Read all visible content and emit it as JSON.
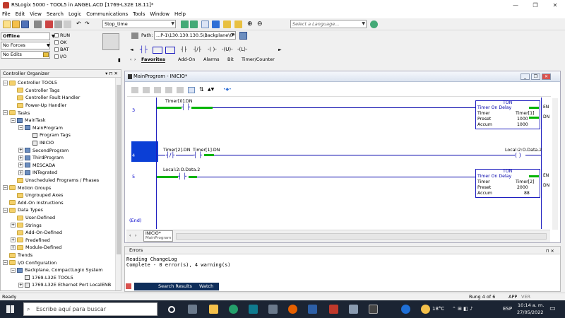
{
  "window": {
    "title": "RSLogix 5000 - TOOL5 in ANGEL.ACD [1769-L32E 18.11]*",
    "controls": [
      "—",
      "❐",
      "✕"
    ]
  },
  "menu": [
    "File",
    "Edit",
    "View",
    "Search",
    "Logic",
    "Communications",
    "Tools",
    "Window",
    "Help"
  ],
  "toolbar": {
    "search_combo": "Stop_time",
    "language_placeholder": "Select a Language...",
    "path_label": "Path:",
    "path_value": "...P-1\\130.130.130.5\\Backplane\\0*",
    "ladder_tabs": [
      "Favorites",
      "Add-On",
      "Alarms",
      "Bit",
      "Timer/Counter"
    ],
    "ladder_symbols": [
      "┤├",
      "┤/├",
      "-( )-",
      "-(U)-",
      "-(L)-"
    ]
  },
  "status": {
    "mode": "Offline",
    "forces": "No Forces",
    "edits": "No Edits",
    "checks": [
      "RUN",
      "OK",
      "BAT",
      "I/O"
    ]
  },
  "organizer": {
    "title": "Controller Organizer",
    "pin": "▾ ⊓ ✕",
    "items": [
      {
        "label": "Controller TOOL5",
        "indent": 0,
        "icon": "folder",
        "exp": "−"
      },
      {
        "label": "Controller Tags",
        "indent": 1,
        "icon": "folder",
        "exp": ""
      },
      {
        "label": "Controller Fault Handler",
        "indent": 1,
        "icon": "folder",
        "exp": ""
      },
      {
        "label": "Power-Up Handler",
        "indent": 1,
        "icon": "folder",
        "exp": ""
      },
      {
        "label": "Tasks",
        "indent": 0,
        "icon": "folder",
        "exp": "−"
      },
      {
        "label": "MainTask",
        "indent": 1,
        "icon": "pgm",
        "exp": "−"
      },
      {
        "label": "MainProgram",
        "indent": 2,
        "icon": "pgm",
        "exp": "−"
      },
      {
        "label": "Program Tags",
        "indent": 3,
        "icon": "rout",
        "exp": ""
      },
      {
        "label": "INICIO",
        "indent": 3,
        "icon": "rout",
        "exp": ""
      },
      {
        "label": "SecondProgram",
        "indent": 2,
        "icon": "pgm",
        "exp": "+"
      },
      {
        "label": "ThirdProgram",
        "indent": 2,
        "icon": "pgm",
        "exp": "+"
      },
      {
        "label": "MESCADA",
        "indent": 2,
        "icon": "pgm",
        "exp": "+"
      },
      {
        "label": "INTegrated",
        "indent": 2,
        "icon": "pgm",
        "exp": "+"
      },
      {
        "label": "Unscheduled Programs / Phases",
        "indent": 1,
        "icon": "folder",
        "exp": ""
      },
      {
        "label": "Motion Groups",
        "indent": 0,
        "icon": "folder",
        "exp": "−"
      },
      {
        "label": "Ungrouped Axes",
        "indent": 1,
        "icon": "folder",
        "exp": ""
      },
      {
        "label": "Add-On Instructions",
        "indent": 0,
        "icon": "folder",
        "exp": ""
      },
      {
        "label": "Data Types",
        "indent": 0,
        "icon": "folder",
        "exp": "−"
      },
      {
        "label": "User-Defined",
        "indent": 1,
        "icon": "folder",
        "exp": ""
      },
      {
        "label": "Strings",
        "indent": 1,
        "icon": "folder",
        "exp": "+"
      },
      {
        "label": "Add-On-Defined",
        "indent": 1,
        "icon": "folder",
        "exp": ""
      },
      {
        "label": "Predefined",
        "indent": 1,
        "icon": "folder",
        "exp": "+"
      },
      {
        "label": "Module-Defined",
        "indent": 1,
        "icon": "folder",
        "exp": "+"
      },
      {
        "label": "Trends",
        "indent": 0,
        "icon": "folder",
        "exp": ""
      },
      {
        "label": "I/O Configuration",
        "indent": 0,
        "icon": "folder",
        "exp": "−"
      },
      {
        "label": "Backplane, CompactLogix System",
        "indent": 1,
        "icon": "pgm",
        "exp": "−"
      },
      {
        "label": "1769-L32E TOOL5",
        "indent": 2,
        "icon": "rout",
        "exp": ""
      },
      {
        "label": "1769-L32E Ethernet Port LocalENB",
        "indent": 2,
        "icon": "rout",
        "exp": "+"
      }
    ]
  },
  "routine": {
    "title": "MainProgram - INICIO*",
    "rungs": [
      {
        "num": "3",
        "contact": "Timer[0].DN"
      },
      {
        "num": "4",
        "contact_a": "Timer[2].DN",
        "contact_b": "Timer[1].DN",
        "output": "Local:2:O.Data.2"
      },
      {
        "num": "5",
        "contact": "Local:2:O.Data.2"
      },
      {
        "num": "(End)"
      }
    ],
    "ton1": {
      "head": "TON",
      "name": "Timer On Delay",
      "timer_lbl": "Timer",
      "timer": "Timer[1]",
      "preset_lbl": "Preset",
      "preset": "1000",
      "accum_lbl": "Accum",
      "accum": "1000",
      "en": "EN",
      "dn": "DN"
    },
    "ton2": {
      "head": "TON",
      "name": "Timer On Delay",
      "timer_lbl": "Timer",
      "timer": "Timer[2]",
      "preset_lbl": "Preset",
      "preset": "2000",
      "accum_lbl": "Accum",
      "accum": "88",
      "en": "EN",
      "dn": "DN"
    },
    "bottom_tab": "INICIO*",
    "bottom_tab_sub": "MainProgram"
  },
  "errors": {
    "title": "Errors",
    "lines": "Reading ChangeLog\nComplete - 0 error(s), 4 warning(s)",
    "tabs": [
      "Search Results",
      "Watch"
    ]
  },
  "statusbar": {
    "left": "Ready",
    "rung": "Rung 4 of 6",
    "app": "APP",
    "ver": "VER"
  },
  "taskbar": {
    "search_placeholder": "Escribe aquí para buscar",
    "temp": "18°C",
    "lang": "ESP",
    "time": "10:14 a. m.",
    "date": "27/05/2022"
  }
}
